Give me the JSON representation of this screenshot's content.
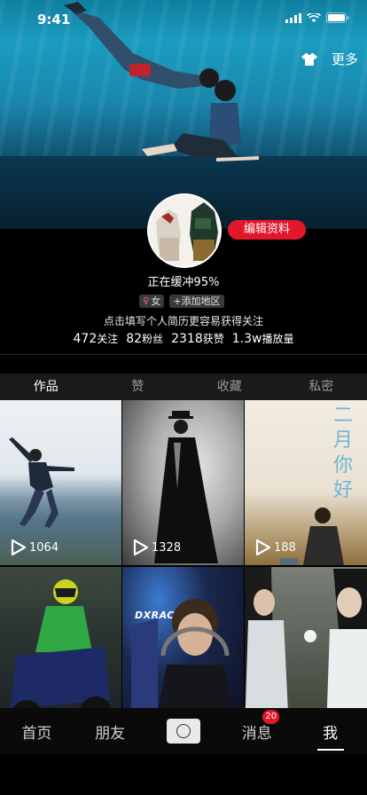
{
  "status": {
    "time": "9:41"
  },
  "header": {
    "more_label": "更多"
  },
  "profile": {
    "edit_button": "编辑资料",
    "nickname": "正在缓冲95%",
    "gender_tag": "女",
    "region_tag": "+添加地区",
    "bio": "点击填写个人简历更容易获得关注",
    "stats": [
      {
        "value": "472",
        "label": "关注"
      },
      {
        "value": "82",
        "label": "粉丝"
      },
      {
        "value": "2318",
        "label": "获赞"
      },
      {
        "value": "1.3w",
        "label": "播放量"
      }
    ]
  },
  "tabs": [
    "作品",
    "赞",
    "收藏",
    "私密"
  ],
  "videos": [
    {
      "plays": "1064"
    },
    {
      "plays": "1328"
    },
    {
      "plays": "188",
      "overlay_text": "二月你好"
    },
    {
      "plays": ""
    },
    {
      "plays": "",
      "overlay_text": "DXRACER"
    },
    {
      "plays": ""
    }
  ],
  "bottom_nav": {
    "home": "首页",
    "friends": "朋友",
    "messages": "消息",
    "messages_badge": "20",
    "me": "我"
  },
  "colors": {
    "accent": "#e3172b",
    "background": "#000000",
    "tab_bar": "#1a1a1a"
  }
}
